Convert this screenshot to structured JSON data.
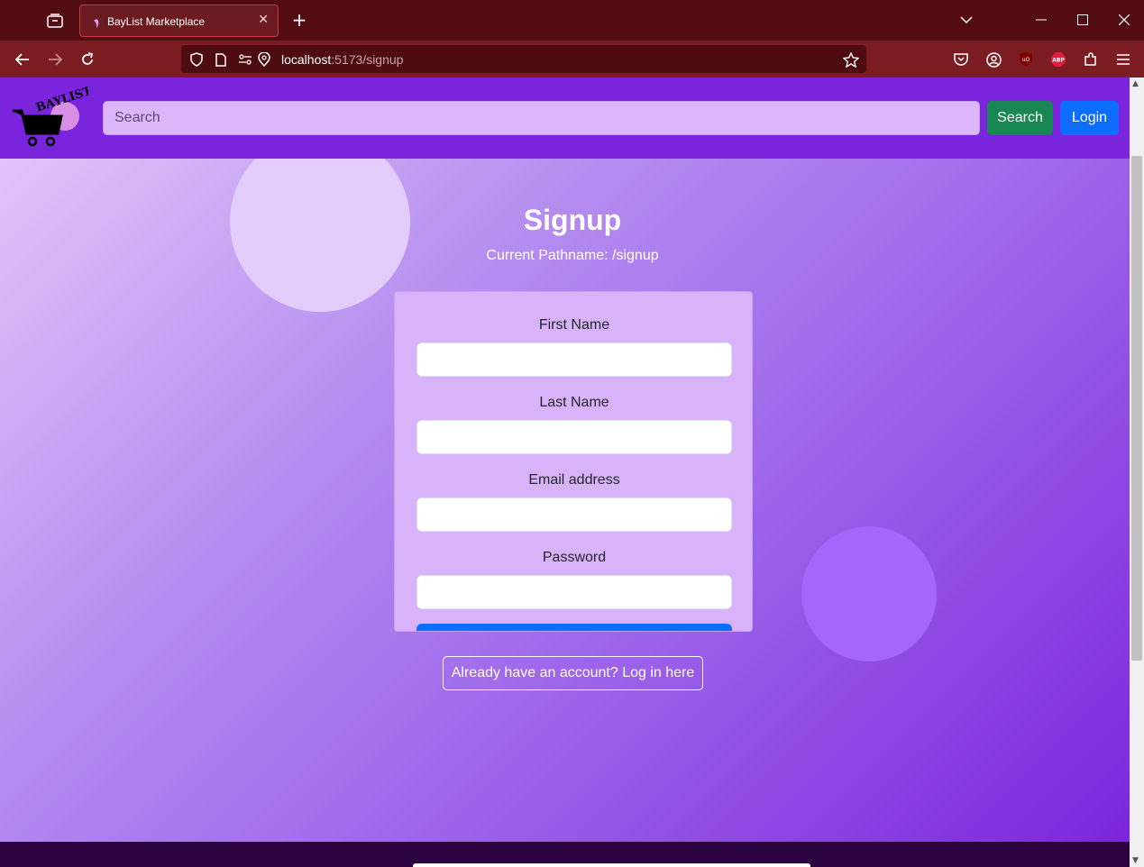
{
  "browser": {
    "tab_title": "BayList Marketplace",
    "url_host": "localhost",
    "url_path": ":5173/signup"
  },
  "site": {
    "logo_text": "BAYLIST",
    "search_placeholder": "Search",
    "search_button": "Search",
    "login_button": "Login"
  },
  "page": {
    "title": "Signup",
    "pathname": "Current Pathname: /signup"
  },
  "form": {
    "fields": [
      {
        "label": "First Name",
        "value": ""
      },
      {
        "label": "Last Name",
        "value": ""
      },
      {
        "label": "Email address",
        "value": ""
      },
      {
        "label": "Password",
        "value": ""
      }
    ]
  },
  "login_link": "Already have an account? Log in here",
  "colors": {
    "header": "#7a24de",
    "search_button": "#198754",
    "login_button": "#0d6efd",
    "card": "#d9b3fa",
    "footer": "#2d0240"
  }
}
